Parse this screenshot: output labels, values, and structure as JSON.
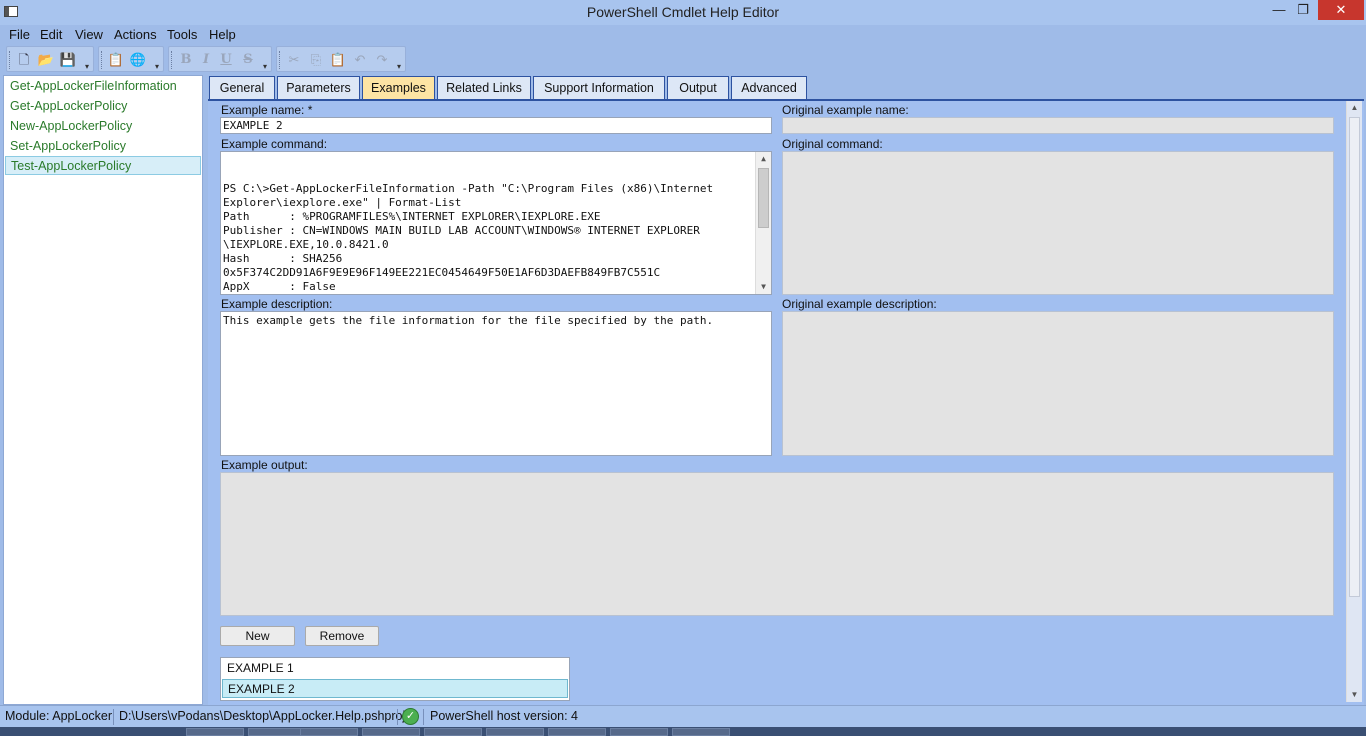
{
  "window": {
    "title": "PowerShell Cmdlet Help Editor",
    "minimize": "—",
    "maximize": "❐",
    "close": "✕"
  },
  "menu": [
    "File",
    "Edit",
    "View",
    "Actions",
    "Tools",
    "Help"
  ],
  "toolbar": {
    "new": "🗋",
    "open": "📂",
    "save": "💾",
    "import": "📋",
    "web": "🌐",
    "bold": "B",
    "italic": "I",
    "underline": "U",
    "strike": "S",
    "cut": "✂",
    "copy": "⎘",
    "paste": "📋",
    "undo": "↶",
    "redo": "↷",
    "more": "▾"
  },
  "cmdlets": [
    "Get-AppLockerFileInformation",
    "Get-AppLockerPolicy",
    "New-AppLockerPolicy",
    "Set-AppLockerPolicy",
    "Test-AppLockerPolicy"
  ],
  "selected_cmdlet": "Test-AppLockerPolicy",
  "tabs": [
    "General",
    "Parameters",
    "Examples",
    "Related Links",
    "Support Information",
    "Output",
    "Advanced"
  ],
  "active_tab": "Examples",
  "form": {
    "example_name_label": "Example name: *",
    "example_name_value": "EXAMPLE 2",
    "original_example_name_label": "Original example name:",
    "original_example_name_value": "",
    "example_command_label": "Example command:",
    "example_command_value": "PS C:\\>Get-AppLockerFileInformation -Path \"C:\\Program Files (x86)\\Internet\nExplorer\\iexplore.exe\" | Format-List\nPath      : %PROGRAMFILES%\\INTERNET EXPLORER\\IEXPLORE.EXE\nPublisher : CN=WINDOWS MAIN BUILD LAB ACCOUNT\\WINDOWS® INTERNET EXPLORER\n\\IEXPLORE.EXE,10.0.8421.0\nHash      : SHA256\n0x5F374C2DD91A6F9E9E96F149EE221EC0454649F50E1AF6D3DAEFB849FB7C551C\nAppX      : False",
    "original_command_label": "Original command:",
    "original_command_value": "",
    "example_description_label": "Example description:",
    "example_description_value": "This example gets the file information for the file specified by the path.",
    "original_example_description_label": "Original example description:",
    "original_example_description_value": "",
    "example_output_label": "Example output:",
    "example_output_value": ""
  },
  "buttons": {
    "new": "New",
    "remove": "Remove"
  },
  "examples": [
    "EXAMPLE 1",
    "EXAMPLE 2"
  ],
  "selected_example": "EXAMPLE 2",
  "status": {
    "module": "Module: AppLocker",
    "project_path": "D:\\Users\\vPodans\\Desktop\\AppLocker.Help.pshproj",
    "ok_icon": "✓",
    "host_version": "PowerShell host version: 4"
  },
  "scroll": {
    "up": "▲",
    "down": "▼"
  }
}
